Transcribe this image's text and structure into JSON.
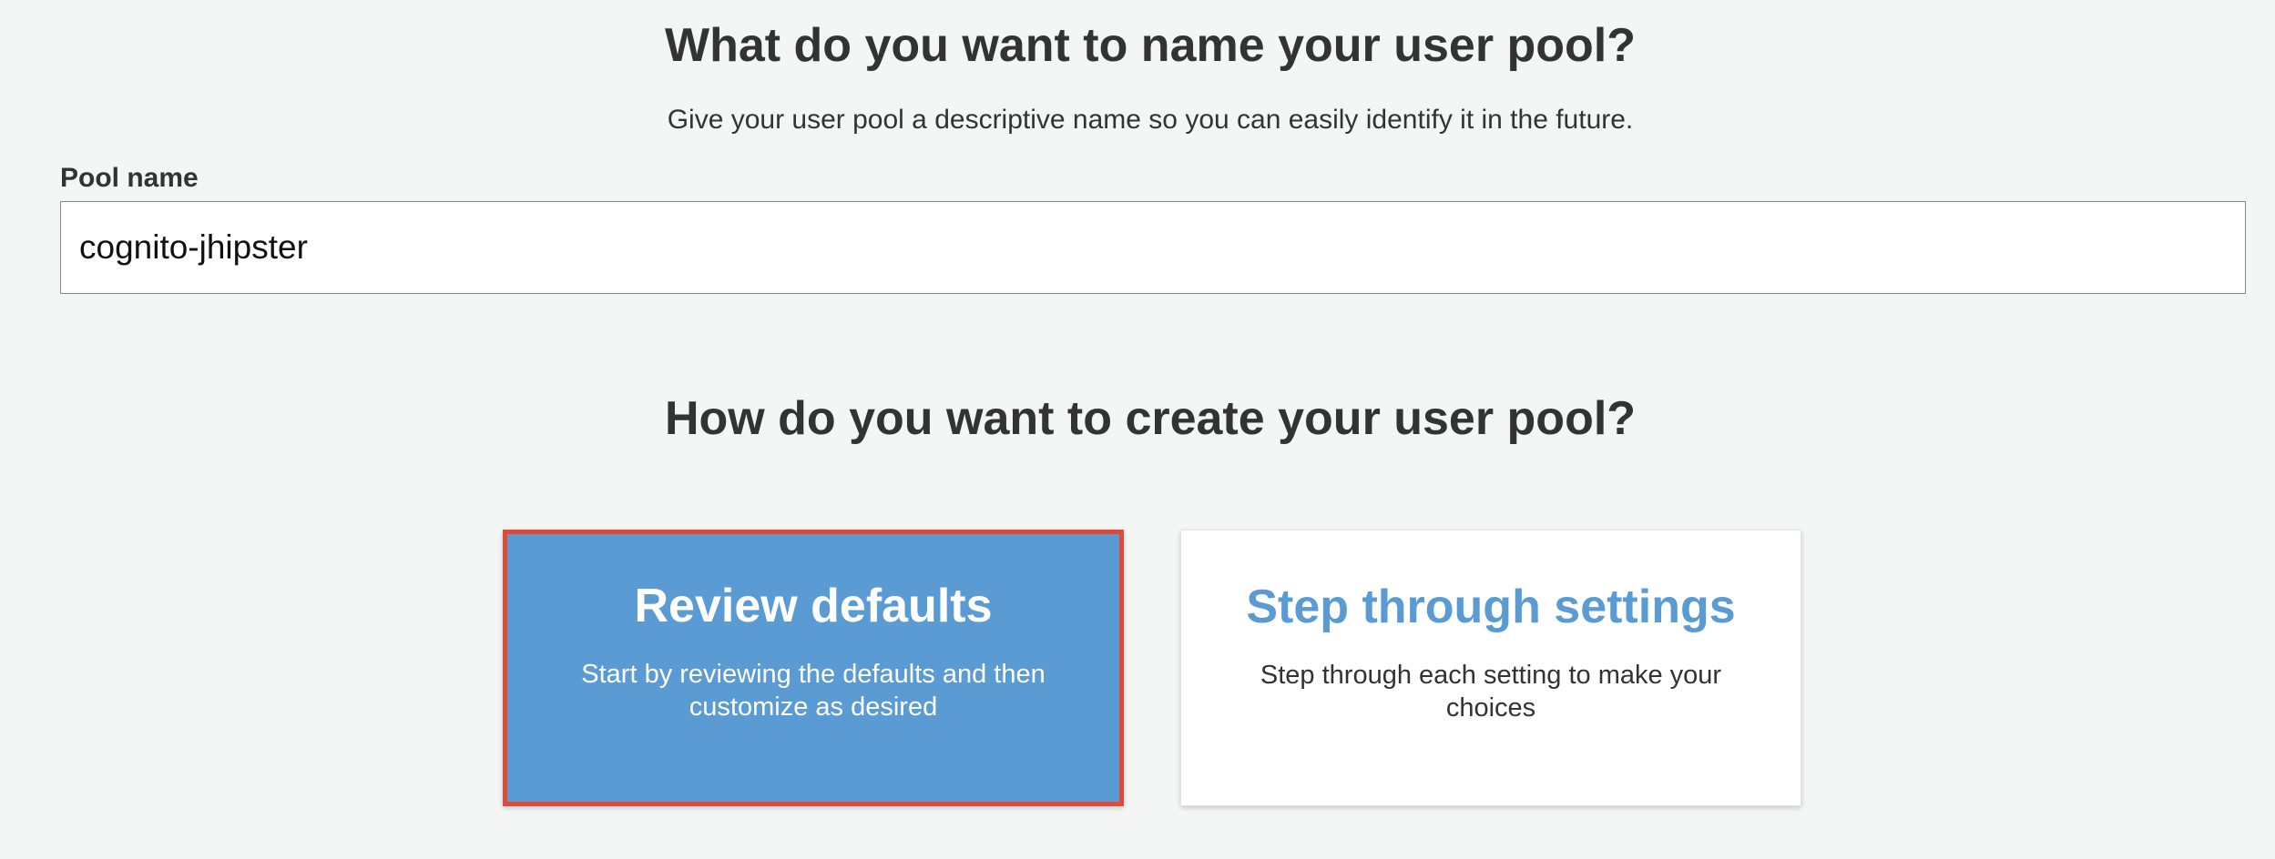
{
  "name_section": {
    "heading": "What do you want to name your user pool?",
    "subtitle": "Give your user pool a descriptive name so you can easily identify it in the future.",
    "pool_name_label": "Pool name",
    "pool_name_value": "cognito-jhipster"
  },
  "create_section": {
    "heading": "How do you want to create your user pool?",
    "options": [
      {
        "title": "Review defaults",
        "description": "Start by reviewing the defaults and then customize as desired",
        "selected": true
      },
      {
        "title": "Step through settings",
        "description": "Step through each setting to make your choices",
        "selected": false
      }
    ]
  },
  "colors": {
    "accent_blue": "#5a9bd3",
    "highlight_red": "#e14a36",
    "page_background": "#f4f6f5"
  }
}
